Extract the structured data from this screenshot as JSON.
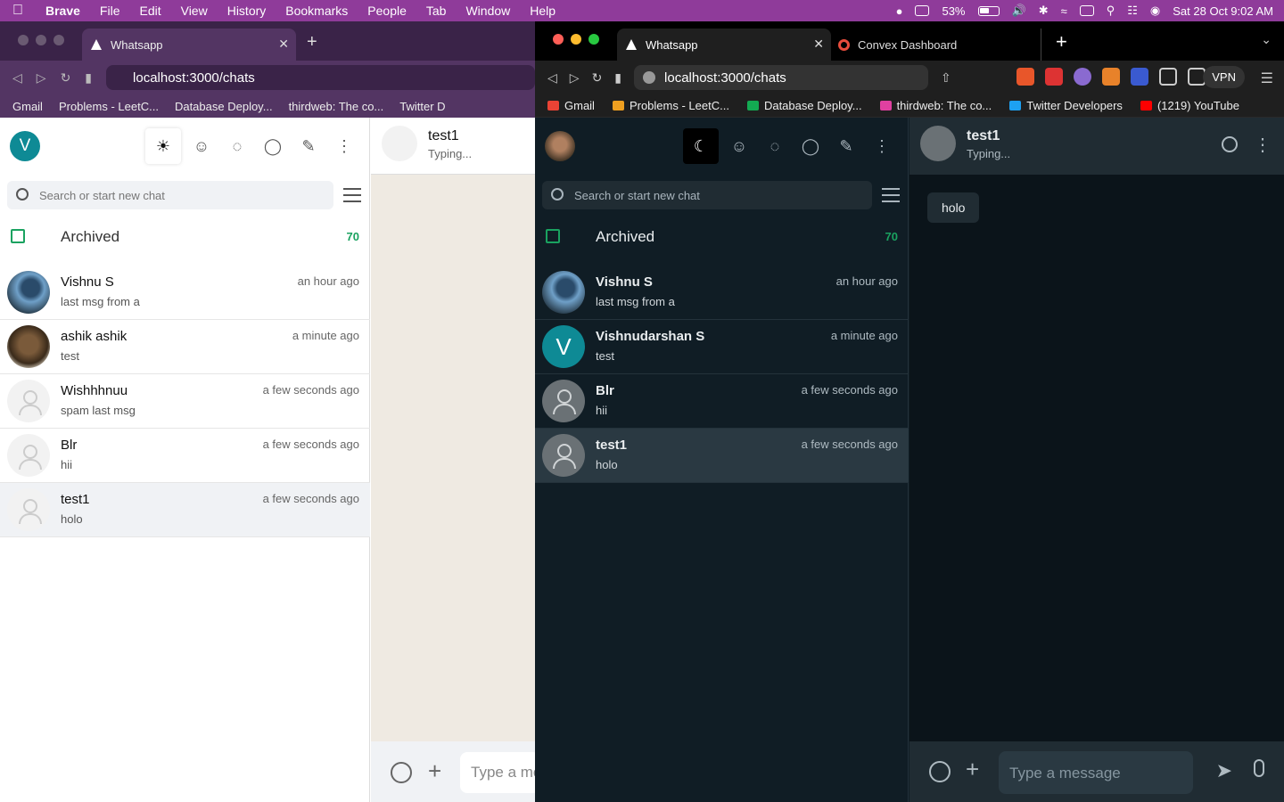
{
  "menubar": {
    "apple_icon": "apple-logo",
    "app_name": "Brave",
    "items": [
      "File",
      "Edit",
      "View",
      "History",
      "Bookmarks",
      "People",
      "Tab",
      "Window",
      "Help"
    ],
    "battery": "53%",
    "clock": "Sat 28 Oct  9:02 AM"
  },
  "left_window": {
    "tab_title": "Whatsapp",
    "url": "localhost:3000/chats",
    "bookmarks": [
      "Gmail",
      "Problems - LeetC...",
      "Database Deploy...",
      "thirdweb: The co...",
      "Twitter D"
    ],
    "user_avatar_letter": "V",
    "search_placeholder": "Search or start new chat",
    "archived_label": "Archived",
    "archived_count": "70",
    "chats": [
      {
        "name": "Vishnu S",
        "time": "an hour ago",
        "last": "last msg from a"
      },
      {
        "name": "ashik ashik",
        "time": "a minute ago",
        "last": "test"
      },
      {
        "name": "Wishhhnuu",
        "time": "a few seconds ago",
        "last": "spam last msg"
      },
      {
        "name": "Blr",
        "time": "a few seconds ago",
        "last": "hii"
      },
      {
        "name": "test1",
        "time": "a few seconds ago",
        "last": "holo"
      }
    ],
    "conversation": {
      "name": "test1",
      "status": "Typing...",
      "input_placeholder": "Type a message"
    }
  },
  "right_window": {
    "tabs": [
      "Whatsapp",
      "Convex Dashboard"
    ],
    "url": "localhost:3000/chats",
    "vpn_label": "VPN",
    "bookmarks": [
      "Gmail",
      "Problems - LeetC...",
      "Database Deploy...",
      "thirdweb: The co...",
      "Twitter Developers",
      "(1219) YouTube"
    ],
    "search_placeholder": "Search or start new chat",
    "archived_label": "Archived",
    "archived_count": "70",
    "chats": [
      {
        "name": "Vishnu S",
        "time": "an hour ago",
        "last": "last msg from a"
      },
      {
        "name": "Vishnudarshan S",
        "time": "a minute ago",
        "last": "test",
        "avatar_letter": "V"
      },
      {
        "name": "Blr",
        "time": "a few seconds ago",
        "last": "hii"
      },
      {
        "name": "test1",
        "time": "a few seconds ago",
        "last": "holo"
      }
    ],
    "conversation": {
      "name": "test1",
      "status": "Typing...",
      "messages": [
        {
          "text": "holo"
        }
      ],
      "input_placeholder": "Type a message"
    }
  },
  "colors": {
    "accent_green": "#1aa260",
    "dark_panel": "#202c33",
    "avatar_teal": "#0e8a95",
    "menubar": "#8f3b9a"
  }
}
